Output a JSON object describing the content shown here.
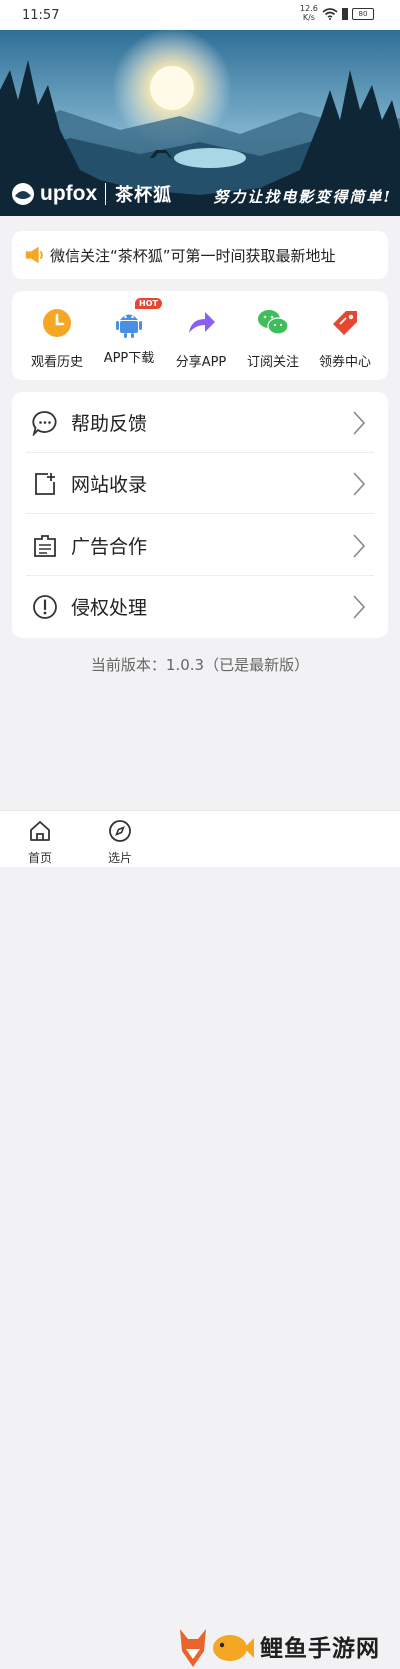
{
  "status_bar": {
    "time": "11:57",
    "net_speed": "12.6",
    "net_unit": "K/s",
    "battery": "80"
  },
  "banner": {
    "logo_text": "upfox",
    "app_name": "茶杯狐",
    "slogan": "努力让找电影变得简单!"
  },
  "notice": {
    "text": "微信关注“茶杯狐”可第一时间获取最新地址"
  },
  "quick_actions": [
    {
      "label": "观看历史",
      "icon": "clock-icon"
    },
    {
      "label": "APP下载",
      "icon": "android-icon",
      "badge": "HOT"
    },
    {
      "label": "分享APP",
      "icon": "share-arrow-icon"
    },
    {
      "label": "订阅关注",
      "icon": "wechat-icon"
    },
    {
      "label": "领券中心",
      "icon": "coupon-tag-icon"
    }
  ],
  "menu": [
    {
      "label": "帮助反馈",
      "icon": "chat-bubble-icon"
    },
    {
      "label": "网站收录",
      "icon": "add-page-icon"
    },
    {
      "label": "广告合作",
      "icon": "document-icon"
    },
    {
      "label": "侵权处理",
      "icon": "alert-circle-icon"
    }
  ],
  "version": "当前版本：1.0.3（已是最新版）",
  "tab_bar": [
    {
      "label": "首页",
      "icon": "home-icon"
    },
    {
      "label": "选片",
      "icon": "compass-icon"
    }
  ],
  "watermark": {
    "text": "鲤鱼手游网"
  },
  "colors": {
    "accent_orange": "#f5a623",
    "accent_green": "#3fbf5a",
    "accent_purple": "#8e5ef0",
    "accent_red": "#e8472f"
  }
}
